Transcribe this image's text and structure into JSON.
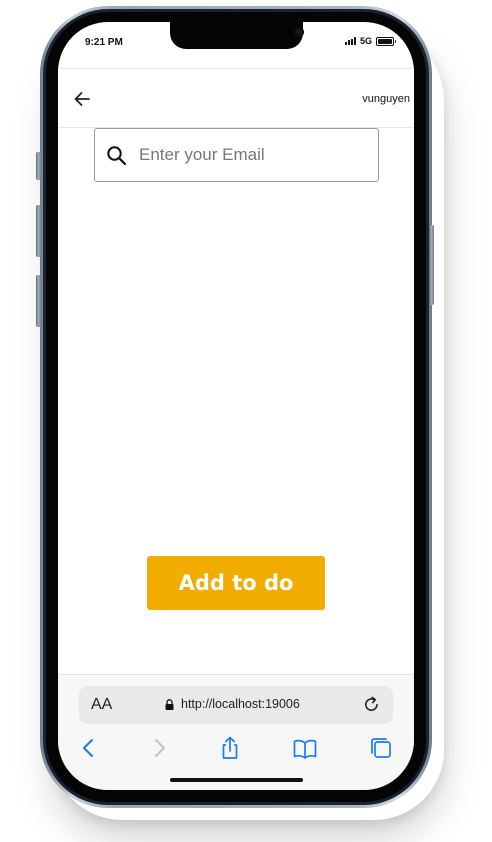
{
  "status_bar": {
    "time": "9:21 PM",
    "network": "5G"
  },
  "header": {
    "user_name": "vunguyen"
  },
  "search": {
    "placeholder": "Enter your Email",
    "value": ""
  },
  "actions": {
    "add_label": "Add to do"
  },
  "browser": {
    "text_size_label": "AA",
    "url": "http://localhost:19006"
  },
  "colors": {
    "accent": "#f0ad00",
    "safari_blue": "#1a7cf0"
  },
  "icons": {
    "back": "arrow-left-icon",
    "search": "search-icon",
    "lock": "lock-icon",
    "reload": "reload-icon",
    "nav_back": "chevron-left-icon",
    "nav_forward": "chevron-right-icon",
    "share": "share-icon",
    "bookmarks": "book-icon",
    "tabs": "tabs-icon"
  }
}
